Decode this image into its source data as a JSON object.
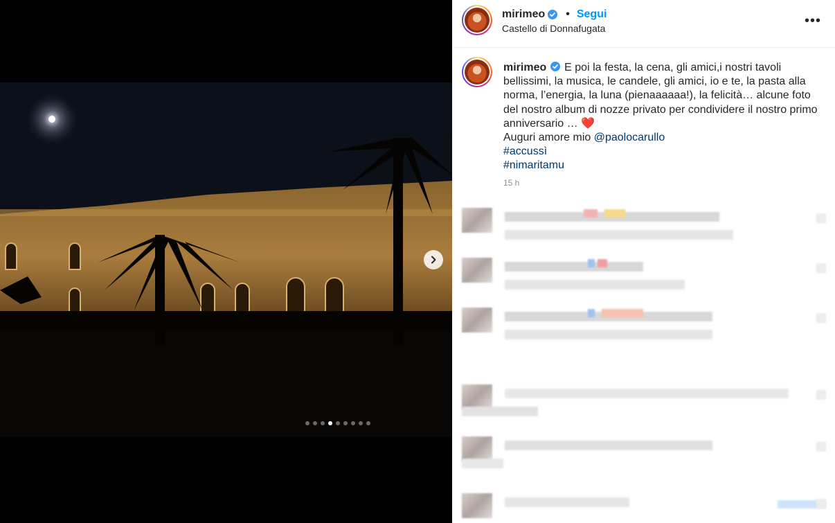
{
  "post": {
    "username": "mirimeo",
    "location": "Castello di Donnafugata",
    "follow_label": "Segui",
    "separator": "•",
    "more_label": "•••",
    "caption_text": "E poi la festa, la cena, gli amici,i nostri tavoli bellissimi, la musica, le candele, gli amici, io e te, la pasta alla norma, l’energia, la luna (pienaaaaaa!), la felicità… alcune foto del nostro album di nozze privato per condividere il nostro primo anniversario … ",
    "heart": "❤️",
    "wish_text": "Auguri amore mio ",
    "mention": "@paolocarullo",
    "hashtags": [
      "#accussì",
      "#nimaritamu"
    ],
    "timestamp": "15 h"
  },
  "carousel": {
    "slide_count": 9,
    "active_index": 3
  },
  "icons": {
    "verified": "verified-badge-icon",
    "next": "chevron-right-icon",
    "more": "more-options-icon"
  },
  "colors": {
    "accent": "#0095f6",
    "text": "#262626",
    "verified": "#3897f0",
    "link": "#00376b"
  }
}
